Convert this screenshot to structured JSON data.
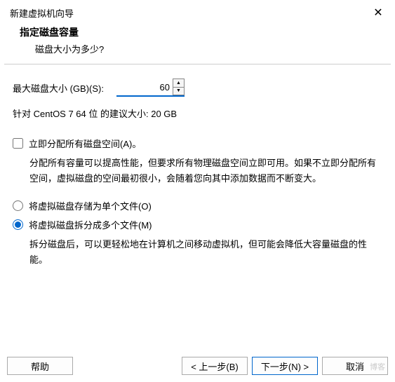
{
  "window": {
    "title": "新建虚拟机向导",
    "close": "✕"
  },
  "header": {
    "heading": "指定磁盘容量",
    "sub": "磁盘大小为多少?"
  },
  "size": {
    "label": "最大磁盘大小 (GB)(S):",
    "value": "60",
    "recommend": "针对 CentOS 7 64 位 的建议大小: 20 GB"
  },
  "allocate": {
    "label": "立即分配所有磁盘空间(A)。",
    "checked": false,
    "desc": "分配所有容量可以提高性能，但要求所有物理磁盘空间立即可用。如果不立即分配所有空间，虚拟磁盘的空间最初很小，会随着您向其中添加数据而不断变大。"
  },
  "storage": {
    "single": {
      "label": "将虚拟磁盘存储为单个文件(O)",
      "selected": false
    },
    "split": {
      "label": "将虚拟磁盘拆分成多个文件(M)",
      "selected": true
    },
    "desc": "拆分磁盘后，可以更轻松地在计算机之间移动虚拟机，但可能会降低大容量磁盘的性能。"
  },
  "buttons": {
    "help": "帮助",
    "back": "< 上一步(B)",
    "next": "下一步(N) >",
    "cancel": "取消"
  },
  "watermark": "博客"
}
